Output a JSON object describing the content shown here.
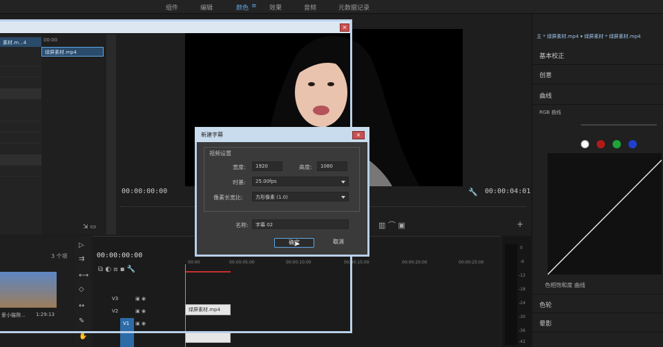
{
  "workspaces": [
    "组件",
    "编辑",
    "颜色",
    "效果",
    "音频",
    "元数据记录"
  ],
  "active_workspace": "颜色",
  "program": {
    "timecode_in": "00:00:00:00",
    "timecode_out": "00:00:04:01"
  },
  "project": {
    "item_label": "绿屏素材.mp4",
    "left_item": "素材.m...4",
    "time_hdr": "00:00"
  },
  "lumetri": {
    "clip": "主 * 绿屏素材.mp4 ▾ 绿屏素材 * 绿屏素材.mp4",
    "sections": [
      "基本校正",
      "创意",
      "曲线"
    ],
    "rgb_curve": "RGB 曲线",
    "hue_sat": "色相饱和度 曲线",
    "color_wheels": "色轮",
    "vignette": "晕影"
  },
  "timeline": {
    "timecode": "00:00:00:00",
    "clip_name": "绿屏素材.mp4",
    "tracks": [
      "V3",
      "V2",
      "V1"
    ],
    "ruler": [
      "00:00",
      "00:00:05:00",
      "00:00:10:00",
      "00:00:15:00",
      "00:00:20:00",
      "00:00:25:00"
    ],
    "bin_count": "3 个项",
    "bin_clip": "爱小猫爬...",
    "bin_dur": "1:29:13"
  },
  "meter": [
    "0",
    "-6",
    "-12",
    "-18",
    "-24",
    "-30",
    "-36",
    "-42"
  ],
  "dialog": {
    "title": "新建字幕",
    "group": "视频设置",
    "width_label": "宽度:",
    "width_value": "1920",
    "height_label": "高度:",
    "height_value": "1080",
    "timebase_label": "时基:",
    "timebase_value": "25.00fps",
    "pixel_label": "像素长宽比:",
    "pixel_value": "方形像素 (1.0)",
    "name_label": "名称:",
    "name_value": "字幕 02",
    "ok": "确定",
    "cancel": "取消"
  },
  "colors": {
    "accent": "#5fa8e8",
    "dialog_frame": "#b9d1ea",
    "close_red": "#c75050"
  }
}
